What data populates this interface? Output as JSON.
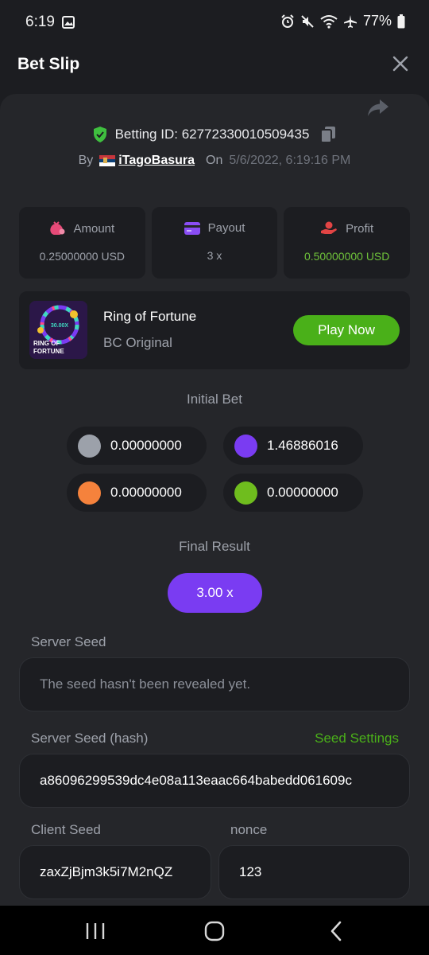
{
  "status_bar": {
    "time": "6:19",
    "battery": "77%"
  },
  "header": {
    "title": "Bet Slip"
  },
  "bet": {
    "id_label": "Betting ID:",
    "id_value": "62772330010509435",
    "by_label": "By",
    "username": "iTagoBasura",
    "on_label": "On",
    "date": "5/6/2022, 6:19:16 PM"
  },
  "stats": [
    {
      "label": "Amount",
      "value": "0.25000000 USD",
      "icon": "money-bag-icon",
      "color": "#e64a78"
    },
    {
      "label": "Payout",
      "value": "3 x",
      "icon": "card-icon",
      "color": "#8a4df5"
    },
    {
      "label": "Profit",
      "value": "0.50000000 USD",
      "icon": "hand-coin-icon",
      "color": "#e24444"
    }
  ],
  "game": {
    "name": "Ring of Fortune",
    "provider": "BC Original",
    "play_label": "Play Now",
    "thumb_text_top": "30.00X",
    "thumb_text_line1": "RING OF",
    "thumb_text_line2": "FORTUNE"
  },
  "initial_bet": {
    "label": "Initial Bet",
    "chips": [
      {
        "value": "0.00000000",
        "color": "#9ca1aa"
      },
      {
        "value": "1.46886016",
        "color": "#7a3cf2"
      },
      {
        "value": "0.00000000",
        "color": "#f5823c"
      },
      {
        "value": "0.00000000",
        "color": "#6fbd1e"
      }
    ]
  },
  "final_result": {
    "label": "Final Result",
    "value": "3.00 x"
  },
  "server_seed": {
    "label": "Server Seed",
    "placeholder": "The seed hasn't been revealed yet."
  },
  "server_seed_hash": {
    "label": "Server Seed (hash)",
    "link": "Seed Settings",
    "value": "a86096299539dc4e08a113eaac664babedd061609c"
  },
  "client_seed": {
    "label": "Client Seed",
    "value": "zaxZjBjm3k5i7M2nQZ"
  },
  "nonce": {
    "label": "nonce",
    "value": "123"
  }
}
